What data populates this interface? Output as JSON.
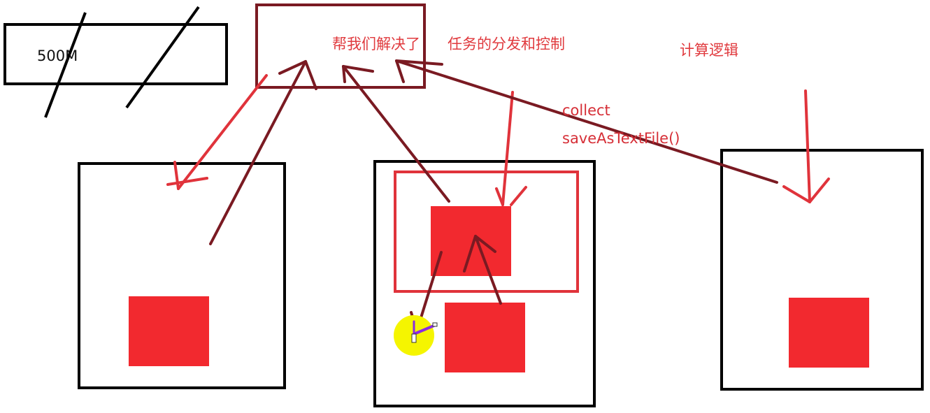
{
  "labels": {
    "size_label": "500M",
    "driver_note": "帮我们解决了",
    "driver_note2": "任务的分发和控制",
    "compute_logic": "计算逻辑",
    "collect": "collect",
    "save_as_text": "saveAsTextFile()"
  },
  "colors": {
    "background": "#ffffff",
    "box_outline": "#000000",
    "driver_box": "#7a1a22",
    "partition_fill": "#f2292f",
    "task_outline": "#e0333b",
    "arrow_dark": "#7a1a22",
    "arrow_red": "#e0333b",
    "cursor_highlight": "#f5f500",
    "cursor_pen": "#8a2be2",
    "text_red": "#e03a3e"
  }
}
